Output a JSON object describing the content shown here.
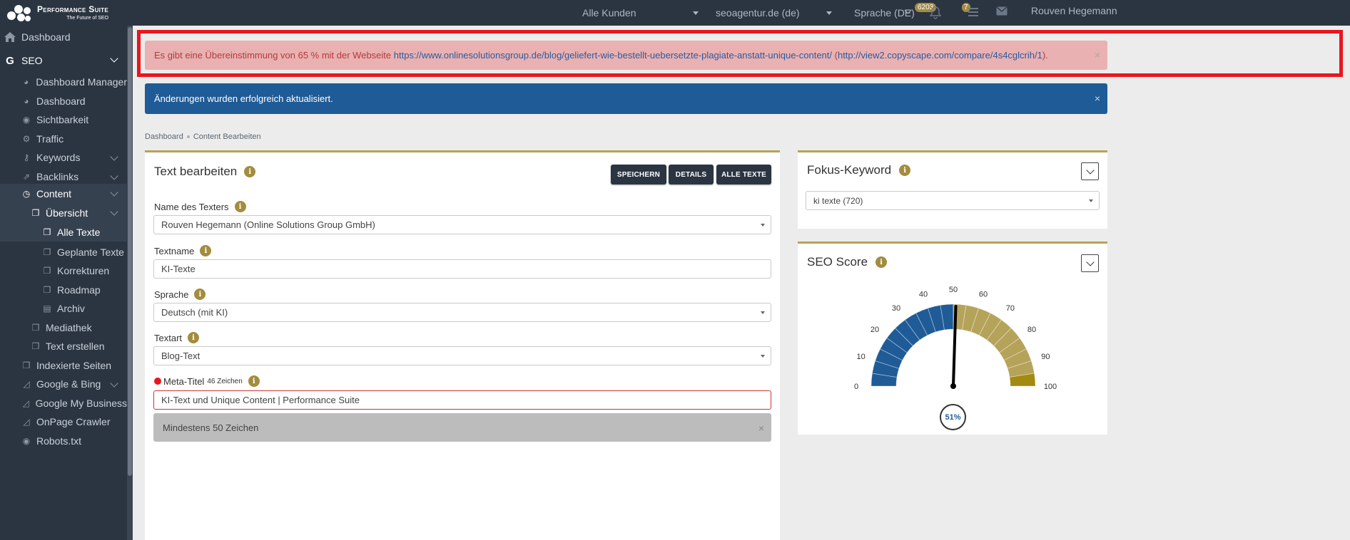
{
  "topbar": {
    "logo_title": "Performance Suite",
    "logo_tagline": "The Future of SEO",
    "customer_select": "Alle Kunden",
    "domain_select": "seoagentur.de (de)",
    "language_select": "Sprache (DE)",
    "notifications_badge": "6203",
    "tasks_badge": "7",
    "user_name": "Rouven Hegemann"
  },
  "sidebar": {
    "items": [
      {
        "label": "Dashboard",
        "icon": "home-icon"
      },
      {
        "label": "SEO",
        "icon": "google-g-icon"
      },
      {
        "label": "Dashboard Manager",
        "icon": "dashboard-gauge-icon"
      },
      {
        "label": "Dashboard",
        "icon": "dashboard-gauge-icon"
      },
      {
        "label": "Sichtbarkeit",
        "icon": "eye-icon"
      },
      {
        "label": "Traffic",
        "icon": "gears-icon"
      },
      {
        "label": "Keywords",
        "icon": "key-icon"
      },
      {
        "label": "Backlinks",
        "icon": "external-link-icon"
      },
      {
        "label": "Content",
        "icon": "clock-icon"
      },
      {
        "label": "Übersicht",
        "icon": "copy-icon"
      },
      {
        "label": "Alle Texte",
        "icon": "copy-icon"
      },
      {
        "label": "Geplante Texte",
        "icon": "copy-icon"
      },
      {
        "label": "Korrekturen",
        "icon": "copy-icon"
      },
      {
        "label": "Roadmap",
        "icon": "copy-icon"
      },
      {
        "label": "Archiv",
        "icon": "archive-icon"
      },
      {
        "label": "Mediathek",
        "icon": "copy-icon"
      },
      {
        "label": "Text erstellen",
        "icon": "copy-icon"
      },
      {
        "label": "Indexierte Seiten",
        "icon": "copy-icon"
      },
      {
        "label": "Google & Bing",
        "icon": "area-chart-icon"
      },
      {
        "label": "Google My Business",
        "icon": "area-chart-icon"
      },
      {
        "label": "OnPage Crawler",
        "icon": "area-chart-icon"
      },
      {
        "label": "Robots.txt",
        "icon": "eye-icon"
      }
    ]
  },
  "alerts": {
    "match_prefix": "Es gibt eine Übereinstimmung von 65 % mit der Webseite ",
    "match_url": "https://www.onlinesolutionsgroup.de/blog/geliefert-wie-bestellt-uebersetzte-plagiate-anstatt-unique-content/",
    "match_open_paren": " (",
    "match_compare_url": "http://view2.copyscape.com/compare/4s4cglcrih/1",
    "match_suffix": ").",
    "success": "Änderungen wurden erfolgreich aktualisiert.",
    "close_glyph": "×"
  },
  "breadcrumb": {
    "home": "Dashboard",
    "current": "Content Bearbeiten"
  },
  "editor": {
    "title": "Text bearbeiten",
    "save_button": "SPEICHERN",
    "details_button": "DETAILS",
    "all_texts_button": "ALLE TEXTE",
    "writer_label": "Name des Texters",
    "writer_value": "Rouven Hegemann (Online Solutions Group GmbH)",
    "textname_label": "Textname",
    "textname_value": "KI-Texte",
    "language_label": "Sprache",
    "language_value": "Deutsch (mit KI)",
    "texttype_label": "Textart",
    "texttype_value": "Blog-Text",
    "meta_title_label": "Meta-Titel",
    "meta_title_count": "46 Zeichen",
    "meta_title_value": "KI-Text und Unique Content | Performance Suite",
    "meta_title_warning": "Mindestens 50 Zeichen"
  },
  "focus_keyword": {
    "title": "Fokus-Keyword",
    "value": "ki texte (720)"
  },
  "seo_score": {
    "title": "SEO Score",
    "value_label": "51%",
    "ticks": [
      "0",
      "10",
      "20",
      "30",
      "40",
      "50",
      "60",
      "70",
      "80",
      "90",
      "100"
    ]
  },
  "gauge": {
    "value": 51,
    "min": 0,
    "max": 100,
    "color_low": "#1f5b96",
    "color_high": "#b6a35a",
    "color_end": "#a38a10"
  },
  "info_glyph": "i"
}
